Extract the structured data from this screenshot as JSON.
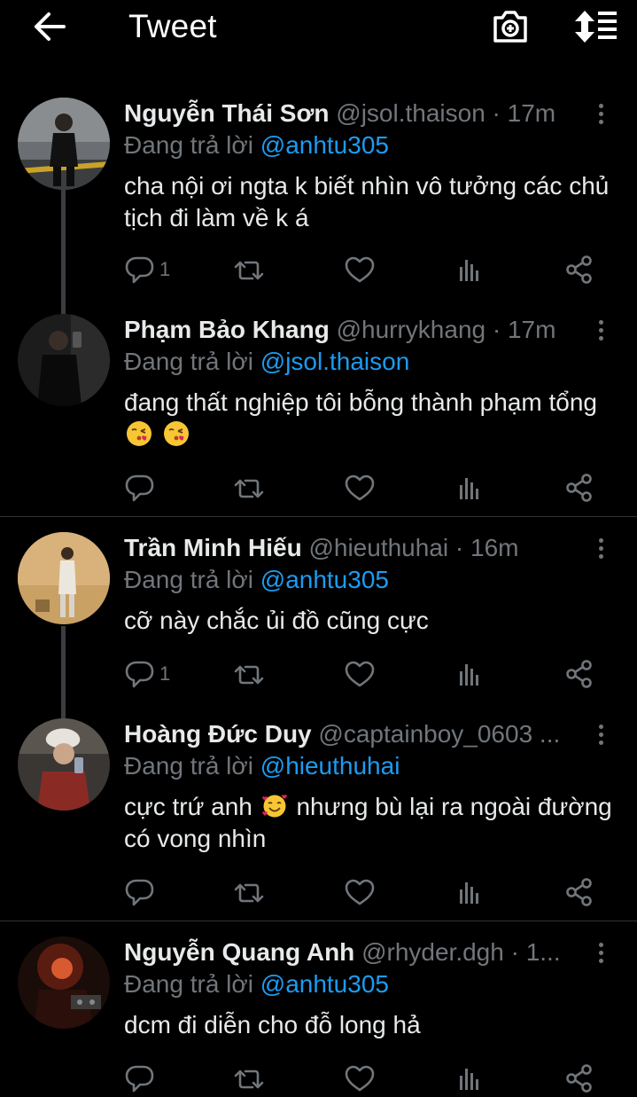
{
  "header": {
    "title": "Tweet",
    "back_icon": "arrow-left-icon",
    "camera_icon": "camera-add-icon",
    "sort_icon": "sort-icon"
  },
  "colors": {
    "background": "#000000",
    "text": "#e7e9ea",
    "muted": "#71767b",
    "accent": "#1d9bf0",
    "divider": "#2f3336"
  },
  "tweets": [
    {
      "name": "Nguyễn Thái Sơn",
      "meta": "@jsol.thaison · 17m",
      "reply_label": "Đang trả lời",
      "reply_handle": "@anhtu305",
      "text": "cha nội ơi ngta k biết nhìn vô tưởng các chủ tịch đi làm về k á",
      "reply_count": "1",
      "retweet_count": "",
      "like_count": ""
    },
    {
      "name": "Phạm Bảo Khang",
      "meta": "@hurrykhang · 17m",
      "reply_label": "Đang trả lời",
      "reply_handle": "@jsol.thaison",
      "text": "đang thất nghiệp tôi bỗng thành phạm tổng",
      "emojis": [
        "kissing-face-emoji",
        "kissing-face-emoji"
      ],
      "reply_count": "",
      "retweet_count": "",
      "like_count": ""
    },
    {
      "name": "Trần Minh Hiếu",
      "meta": "@hieuthuhai · 16m",
      "reply_label": "Đang trả lời",
      "reply_handle": "@anhtu305",
      "text": "cỡ này chắc ủi đồ cũng cực",
      "reply_count": "1",
      "retweet_count": "",
      "like_count": ""
    },
    {
      "name": "Hoàng Đức Duy",
      "meta": "@captainboy_0603 ...",
      "reply_label": "Đang trả lời",
      "reply_handle": "@hieuthuhai",
      "text_before": "cực trứ anh",
      "emoji": "smiling-face-with-hearts-emoji",
      "text_after": "nhưng bù lại ra ngoài đường có vong nhìn",
      "reply_count": "",
      "retweet_count": "",
      "like_count": ""
    },
    {
      "name": "Nguyễn Quang Anh",
      "meta": "@rhyder.dgh · 1...",
      "reply_label": "Đang trả lời",
      "reply_handle": "@anhtu305",
      "text": "dcm đi diễn cho đỗ long hả",
      "reply_count": "",
      "retweet_count": "",
      "like_count": ""
    }
  ]
}
